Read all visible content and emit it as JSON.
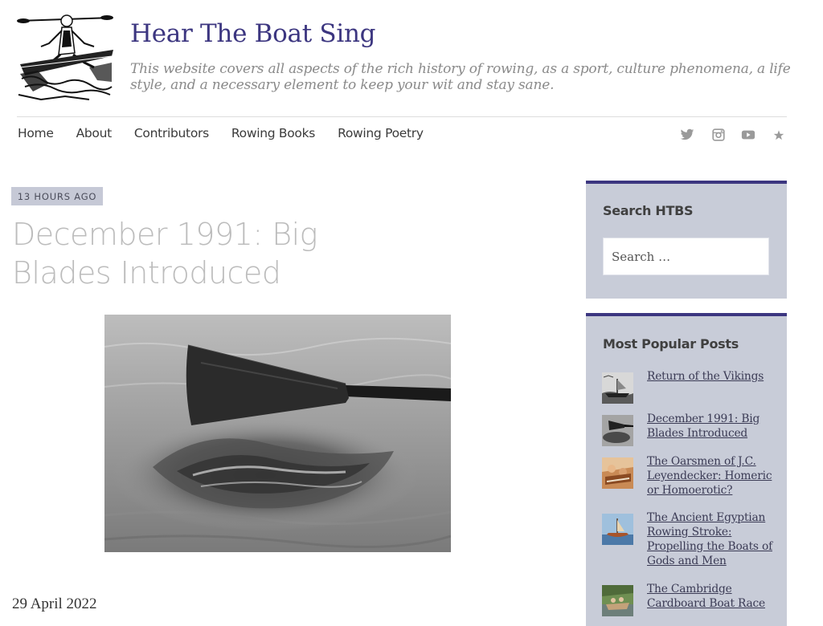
{
  "site": {
    "title": "Hear The Boat Sing",
    "description": "This website covers all aspects of the rich history of rowing, as a sport, culture phenomena, a life style, and a necessary element to keep your wit and stay sane.",
    "logo_icon": "rower-sculler-logo"
  },
  "nav": {
    "items": [
      {
        "label": "Home"
      },
      {
        "label": "About"
      },
      {
        "label": "Contributors"
      },
      {
        "label": "Rowing Books"
      },
      {
        "label": "Rowing Poetry"
      }
    ],
    "social_icons": [
      "twitter-icon",
      "instagram-icon",
      "youtube-icon",
      "star-icon"
    ],
    "icon_color": "#9a9a9a"
  },
  "post": {
    "badge": "13 HOURS AGO",
    "title_line1": "December 1991: Big",
    "title_line2": "Blades Introduced",
    "image": "oar-blade-in-water-photo",
    "date": "29 April 2022"
  },
  "sidebar": {
    "search": {
      "title": "Search HTBS",
      "placeholder": "Search …"
    },
    "popular": {
      "title": "Most Popular Posts",
      "items": [
        {
          "label": "Return of the Vikings",
          "thumb": "viking-ship-thumb"
        },
        {
          "label": "December 1991: Big Blades Introduced",
          "thumb": "oar-blade-thumb"
        },
        {
          "label": "The Oarsmen of J.C. Leyendecker: Homeric or Homoerotic?",
          "thumb": "painting-thumb"
        },
        {
          "label": "The Ancient Egyptian Rowing Stroke: Propelling the Boats of Gods and Men",
          "thumb": "egyptian-boat-thumb"
        },
        {
          "label": "The Cambridge Cardboard Boat Race",
          "thumb": "cardboard-boat-thumb"
        }
      ]
    }
  },
  "colors": {
    "accent": "#3c3680",
    "sidebar_bg": "#c8ccd8",
    "badge_bg": "#c6c9d6",
    "title_gray": "#bcbcbc"
  }
}
